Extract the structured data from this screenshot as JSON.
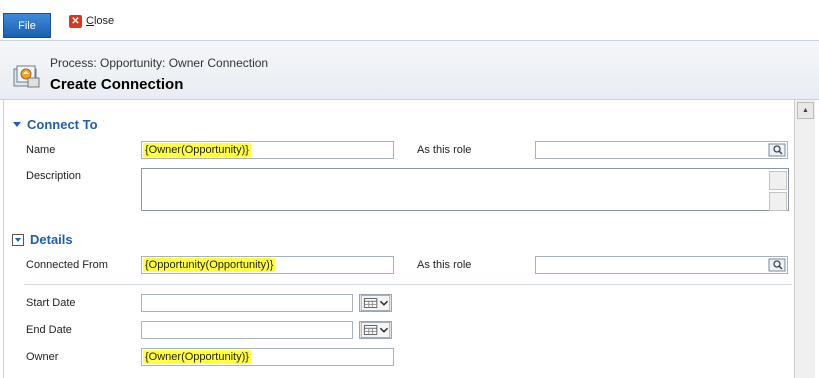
{
  "ribbon": {
    "file_label": "File",
    "close_label": "Close"
  },
  "header": {
    "process_label": "Process: Opportunity: Owner Connection",
    "title": "Create Connection"
  },
  "connect_to": {
    "heading": "Connect To",
    "name_label": "Name",
    "name_value": "{Owner(Opportunity)}",
    "role_label": "As this role",
    "role_value": "",
    "description_label": "Description",
    "description_value": ""
  },
  "details": {
    "heading": "Details",
    "connected_from_label": "Connected From",
    "connected_from_value": "{Opportunity(Opportunity)}",
    "role_label": "As this role",
    "role_value": "",
    "start_date_label": "Start Date",
    "start_date_value": "",
    "end_date_label": "End Date",
    "end_date_value": "",
    "owner_label": "Owner",
    "owner_value": "{Owner(Opportunity)}"
  },
  "colors": {
    "accent": "#1f5fb0",
    "highlight": "#ffff3d",
    "file_button": "#2a6fc4"
  },
  "icons": [
    "close-icon",
    "process-icon",
    "lookup-icon",
    "calendar-icon",
    "expand-icon",
    "collapse-icon"
  ]
}
